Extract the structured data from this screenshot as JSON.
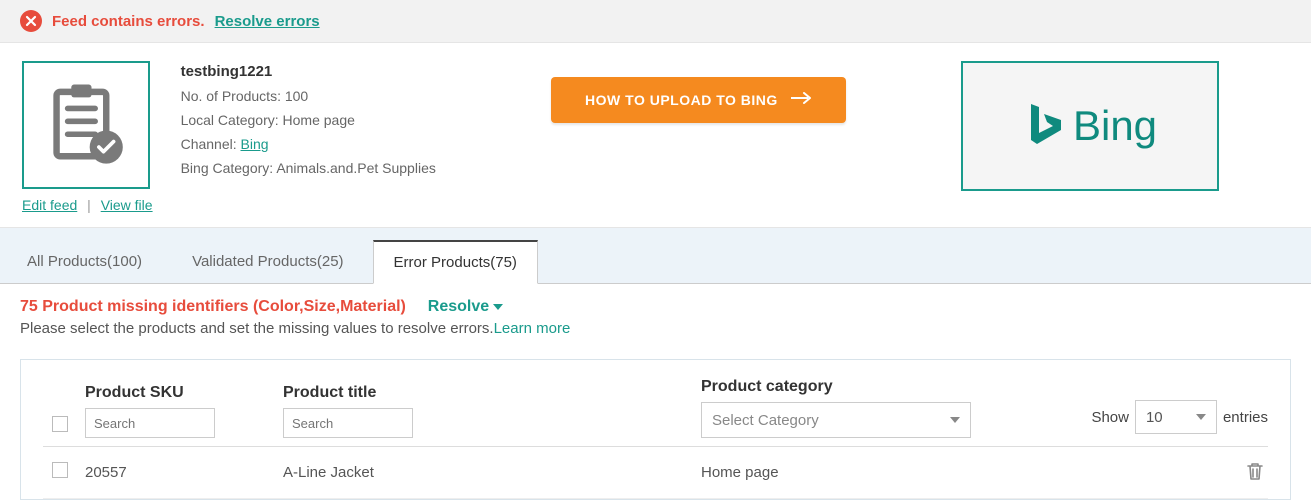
{
  "alert": {
    "message": "Feed contains errors.",
    "resolve_label": "Resolve errors"
  },
  "feed": {
    "title": "testbing1221",
    "products_label": "No. of Products:",
    "products_count": "100",
    "local_category_label": "Local Category:",
    "local_category": "Home page",
    "channel_label": "Channel:",
    "channel": "Bing",
    "channel_category_label": "Bing Category:",
    "channel_category": "Animals.and.Pet Supplies",
    "edit_link": "Edit feed",
    "view_link": "View file"
  },
  "upload_button": "HOW TO UPLOAD TO BING",
  "brand": {
    "name": "Bing"
  },
  "tabs": [
    {
      "label": "All Products(100)",
      "active": false
    },
    {
      "label": "Validated Products(25)",
      "active": false
    },
    {
      "label": "Error Products(75)",
      "active": true
    }
  ],
  "errors": {
    "title": "75 Product missing identifiers (Color,Size,Material)",
    "resolve_label": "Resolve",
    "subtext": "Please select the products and set the missing values to resolve errors.",
    "learn_more": "Learn more"
  },
  "table": {
    "headers": {
      "sku": "Product SKU",
      "title": "Product title",
      "category": "Product category"
    },
    "search_placeholder": "Search",
    "category_placeholder": "Select Category",
    "show_label": "Show",
    "entries_label": "entries",
    "page_size": "10",
    "rows": [
      {
        "sku": "20557",
        "title": "A-Line Jacket",
        "category": "Home page"
      }
    ]
  }
}
